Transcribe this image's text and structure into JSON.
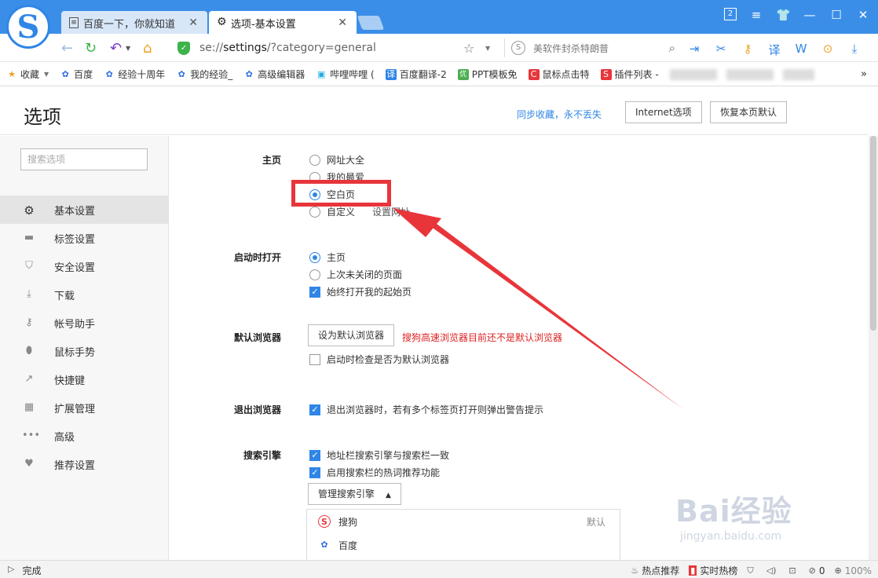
{
  "browser": {
    "tabs": [
      {
        "title": "百度一下，你就知道",
        "active": false
      },
      {
        "title": "选项-基本设置",
        "active": true
      }
    ],
    "tab_count_badge": "2",
    "url_prefix": "se://",
    "url_path": "settings",
    "url_suffix": "/?category=general",
    "search_placeholder": "美软件封杀特朗普",
    "logo_letter": "S"
  },
  "bookmarks": [
    {
      "label": "收藏",
      "icon": "star-icon",
      "color": "#f0a020"
    },
    {
      "label": "百度",
      "icon": "paw-icon",
      "color": "#2f6ee0"
    },
    {
      "label": "经验十周年",
      "icon": "paw-icon",
      "color": "#2f6ee0"
    },
    {
      "label": "我的经验_",
      "icon": "paw-icon",
      "color": "#2f6ee0"
    },
    {
      "label": "高级编辑器",
      "icon": "paw-icon",
      "color": "#2f6ee0"
    },
    {
      "label": "哔哩哔哩 (",
      "icon": "tv-icon",
      "color": "#23ade5"
    },
    {
      "label": "百度翻译-2",
      "icon": "translate-icon",
      "color": "#2f86e6"
    },
    {
      "label": "PPT模板免",
      "icon": "ppt-icon",
      "color": "#4caf50"
    },
    {
      "label": "鼠标点击特",
      "icon": "c-icon",
      "color": "#e8353a"
    },
    {
      "label": "插件列表 -",
      "icon": "sogou-icon",
      "color": "#e8353a"
    }
  ],
  "page": {
    "title": "选项",
    "sync_link": "同步收藏，永不丢失",
    "internet_options": "Internet选项",
    "restore_default": "恢复本页默认"
  },
  "sidebar": {
    "search_placeholder": "搜索选项",
    "items": [
      {
        "label": "基本设置",
        "icon": "gear-icon"
      },
      {
        "label": "标签设置",
        "icon": "tab-icon"
      },
      {
        "label": "安全设置",
        "icon": "shield-icon"
      },
      {
        "label": "下载",
        "icon": "download-icon"
      },
      {
        "label": "帐号助手",
        "icon": "key-icon"
      },
      {
        "label": "鼠标手势",
        "icon": "mouse-icon"
      },
      {
        "label": "快捷键",
        "icon": "shortcut-icon"
      },
      {
        "label": "扩展管理",
        "icon": "grid-icon"
      },
      {
        "label": "高级",
        "icon": "more-icon"
      },
      {
        "label": "推荐设置",
        "icon": "heart-icon"
      }
    ]
  },
  "settings": {
    "homepage": {
      "label": "主页",
      "options": [
        "网址大全",
        "我的最爱",
        "空白页",
        "自定义"
      ],
      "selected": "空白页",
      "set_url_link": "设置网址"
    },
    "startup": {
      "label": "启动时打开",
      "options": [
        "主页",
        "上次未关闭的页面"
      ],
      "selected": "主页",
      "always_open": "始终打开我的起始页",
      "always_open_checked": true
    },
    "default_browser": {
      "label": "默认浏览器",
      "button": "设为默认浏览器",
      "warning": "搜狗高速浏览器目前还不是默认浏览器",
      "check_on_start": "启动时检查是否为默认浏览器",
      "check_on_start_checked": false
    },
    "exit": {
      "label": "退出浏览器",
      "warn_multi": "退出浏览器时，若有多个标签页打开则弹出警告提示",
      "warn_multi_checked": true
    },
    "search": {
      "label": "搜索引擎",
      "sync": "地址栏搜索引擎与搜索栏一致",
      "sync_checked": true,
      "hotwords": "启用搜索栏的热词推荐功能",
      "hotwords_checked": true,
      "manage_button": "管理搜索引擎",
      "engines": [
        {
          "name": "搜狗",
          "default": "默认",
          "icon": "sogou-icon"
        },
        {
          "name": "百度",
          "default": "",
          "icon": "paw-icon"
        }
      ]
    }
  },
  "status": {
    "left": "完成",
    "hot": "热点推荐",
    "realtime": "实时热榜",
    "count": "0",
    "zoom": "100%"
  },
  "watermark": {
    "main": "Bai经验",
    "sub": "jingyan.baidu.com"
  },
  "annotation_color": "#e8353a"
}
